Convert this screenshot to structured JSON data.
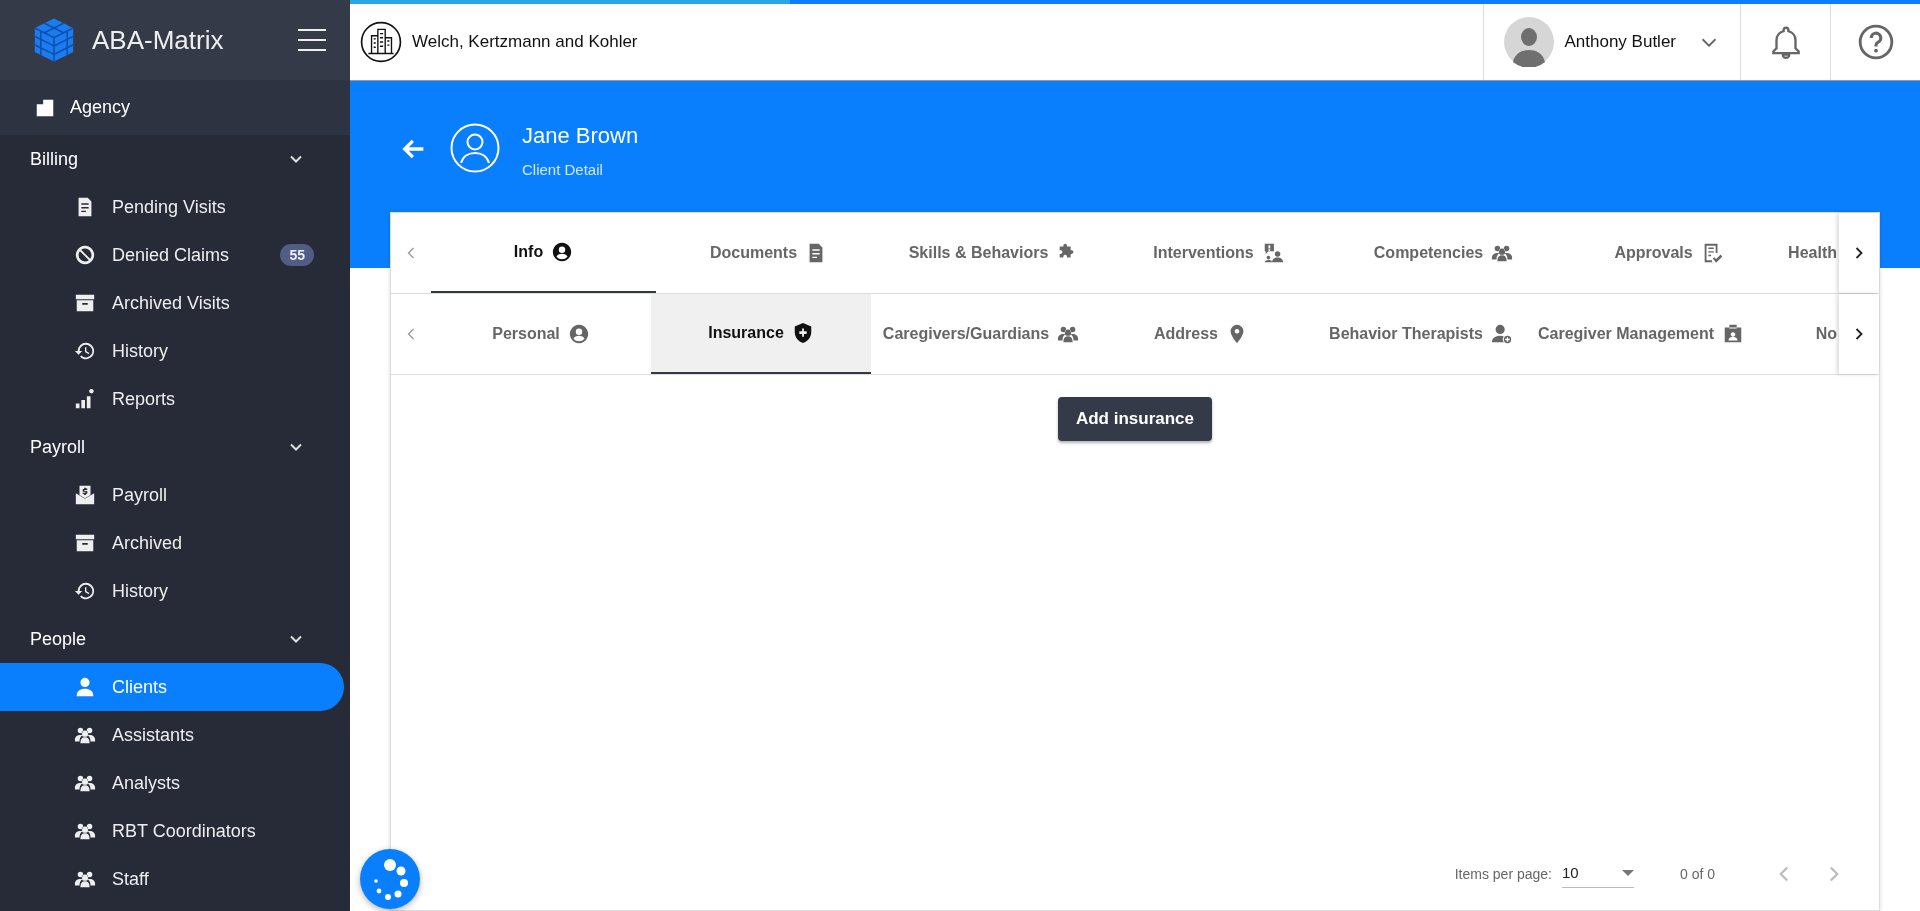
{
  "app": {
    "name": "ABA-Matrix"
  },
  "sidebar": {
    "top_item": {
      "label": "Agency"
    },
    "sections": [
      {
        "label": "Billing",
        "expanded": true,
        "items": [
          {
            "label": "Pending Visits",
            "selected": false
          },
          {
            "label": "Denied Claims",
            "selected": false,
            "badge": "55"
          },
          {
            "label": "Archived Visits",
            "selected": false
          },
          {
            "label": "History",
            "selected": false
          },
          {
            "label": "Reports",
            "selected": false
          }
        ]
      },
      {
        "label": "Payroll",
        "expanded": true,
        "items": [
          {
            "label": "Payroll",
            "selected": false
          },
          {
            "label": "Archived",
            "selected": false
          },
          {
            "label": "History",
            "selected": false
          }
        ]
      },
      {
        "label": "People",
        "expanded": true,
        "items": [
          {
            "label": "Clients",
            "selected": true
          },
          {
            "label": "Assistants",
            "selected": false
          },
          {
            "label": "Analysts",
            "selected": false
          },
          {
            "label": "RBT Coordinators",
            "selected": false
          },
          {
            "label": "Staff",
            "selected": false
          }
        ]
      }
    ]
  },
  "topbar": {
    "organization": "Welch, Kertzmann and Kohler",
    "user": "Anthony Butler"
  },
  "header": {
    "title": "Jane Brown",
    "subtitle": "Client Detail"
  },
  "tabs": [
    {
      "label": "Info",
      "selected": true
    },
    {
      "label": "Documents",
      "selected": false
    },
    {
      "label": "Skills & Behaviors",
      "selected": false
    },
    {
      "label": "Interventions",
      "selected": false
    },
    {
      "label": "Competencies",
      "selected": false
    },
    {
      "label": "Approvals",
      "selected": false
    },
    {
      "label": "Health",
      "selected": false
    }
  ],
  "subtabs": [
    {
      "label": "Personal",
      "selected": false
    },
    {
      "label": "Insurance",
      "selected": true
    },
    {
      "label": "Caregivers/Guardians",
      "selected": false
    },
    {
      "label": "Address",
      "selected": false
    },
    {
      "label": "Behavior Therapists",
      "selected": false
    },
    {
      "label": "Caregiver Management",
      "selected": false
    },
    {
      "label": "No",
      "selected": false
    }
  ],
  "add_button": "Add insurance",
  "paginator": {
    "label": "Items per page:",
    "page_size": "10",
    "range": "0 of 0"
  }
}
